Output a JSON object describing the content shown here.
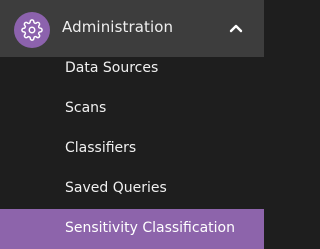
{
  "section": {
    "title": "Administration",
    "icon": "gear-icon",
    "expanded_icon": "chevron-up-icon",
    "accent_color": "#8c62ad"
  },
  "items": [
    {
      "label": "Data Sources",
      "active": false
    },
    {
      "label": "Scans",
      "active": false
    },
    {
      "label": "Classifiers",
      "active": false
    },
    {
      "label": "Saved Queries",
      "active": false
    },
    {
      "label": "Sensitivity Classification",
      "active": true
    }
  ]
}
